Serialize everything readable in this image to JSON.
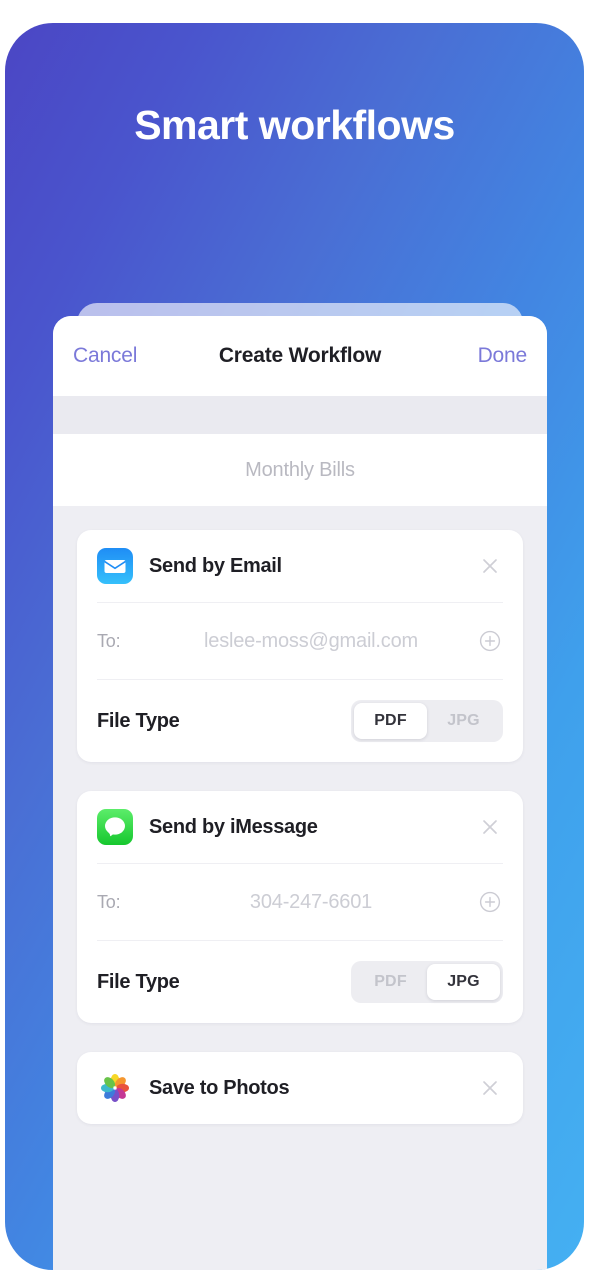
{
  "hero": {
    "title": "Smart workflows"
  },
  "theme": {
    "gradient_start": "#4b46c4",
    "gradient_mid": "#4286e2",
    "gradient_end": "#45b0f2",
    "accent_violet": "#7b79d9",
    "sheet_background": "#eeeef3",
    "card_background": "#ffffff"
  },
  "nav": {
    "cancel_label": "Cancel",
    "title": "Create Workflow",
    "done_label": "Done"
  },
  "name_field": {
    "value": "",
    "placeholder": "Monthly Bills"
  },
  "actions": [
    {
      "icon": "mail-icon",
      "icon_color": "#1ea1f7",
      "title": "Send by Email",
      "close_icon": "close-icon",
      "recipient": {
        "label": "To:",
        "value": "",
        "placeholder": "leslee-moss@gmail.com",
        "add_icon": "plus-circle-icon"
      },
      "file_type": {
        "label": "File Type",
        "options": [
          "PDF",
          "JPG"
        ],
        "selected": "PDF"
      }
    },
    {
      "icon": "message-bubble-icon",
      "icon_color": "#31cf4b",
      "title": "Send by iMessage",
      "close_icon": "close-icon",
      "recipient": {
        "label": "To:",
        "value": "",
        "placeholder": "304-247-6601",
        "add_icon": "plus-circle-icon"
      },
      "file_type": {
        "label": "File Type",
        "options": [
          "PDF",
          "JPG"
        ],
        "selected": "JPG"
      }
    },
    {
      "icon": "photos-pinwheel-icon",
      "icon_color": "#f5a623",
      "title": "Save to Photos",
      "close_icon": "close-icon",
      "recipient": null,
      "file_type": null
    }
  ]
}
